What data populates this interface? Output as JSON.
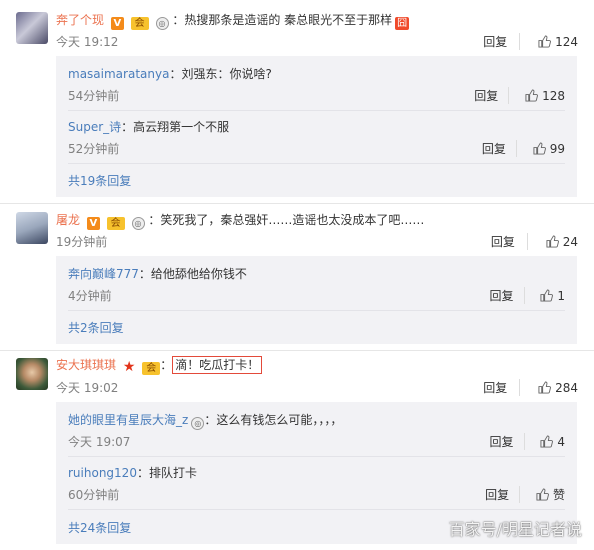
{
  "icons": {
    "thumb": "thumbs-up-icon"
  },
  "colors": {
    "username": "#eb7350",
    "link": "#4a7dbb",
    "meta": "#808080",
    "highlight": "#e34a3a"
  },
  "comments": [
    {
      "user": "奔了个现",
      "badges": [
        "V",
        "vip",
        "medal"
      ],
      "text": "：热搜那条是造谣的 秦总眼光不至于那样",
      "emoji": "囧",
      "time": "今天 19:12",
      "reply_label": "回复",
      "likes": "124",
      "replies": [
        {
          "user": "masaimaratanya",
          "text": "：刘强东：你说啥?",
          "time": "54分钟前",
          "reply_label": "回复",
          "likes": "128"
        },
        {
          "user": "Super_诗",
          "text": "：高云翔第一个不服",
          "time": "52分钟前",
          "reply_label": "回复",
          "likes": "99"
        }
      ],
      "more": "共19条回复"
    },
    {
      "user": "屠龙",
      "badges": [
        "V",
        "vip",
        "medal"
      ],
      "text": "：笑死我了，秦总强奸……造谣也太没成本了吧……",
      "time": "19分钟前",
      "reply_label": "回复",
      "likes": "24",
      "replies": [
        {
          "user": "奔向巅峰777",
          "text": "：给他舔他给你钱不",
          "time": "4分钟前",
          "reply_label": "回复",
          "likes": "1"
        }
      ],
      "more": "共2条回复"
    },
    {
      "user": "安大琪琪琪",
      "badges": [
        "star",
        "vip"
      ],
      "text": "滴！吃瓜打卡！",
      "prefix": "：",
      "time": "今天 19:02",
      "reply_label": "回复",
      "likes": "284",
      "replies": [
        {
          "user": "她的眼里有星辰大海_z",
          "text": "：这么有钱怎么可能，，，，",
          "time": "今天 19:07",
          "reply_label": "回复",
          "likes": "4"
        },
        {
          "user": "ruihong120",
          "text": "：排队打卡",
          "time": "60分钟前",
          "reply_label": "回复",
          "likes": "赞"
        }
      ],
      "more": "共24条回复"
    }
  ],
  "watermark": "百家号/明星记者说"
}
